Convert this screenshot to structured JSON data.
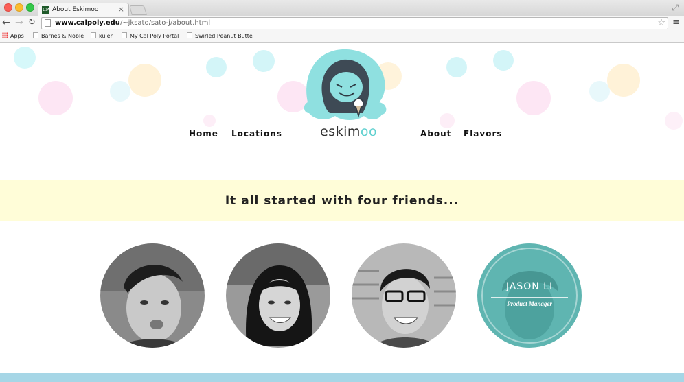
{
  "browser": {
    "tab_title": "About Eskimoo",
    "tab_favicon_text": "CP",
    "url_host": "www.calpoly.edu",
    "url_path": "/~jksato/sato-j/about.html",
    "bookmarks": [
      "Apps",
      "Barnes & Noble",
      "kuler",
      "My Cal Poly Portal",
      "Swirled Peanut Butte"
    ]
  },
  "site": {
    "nav_left": [
      "Home",
      "Locations"
    ],
    "nav_right": [
      "About",
      "Flavors"
    ],
    "logo_prefix": "eskim",
    "logo_accent": "oo",
    "band_heading": "It all started with four friends...",
    "team": [
      {
        "name": "",
        "role": ""
      },
      {
        "name": "",
        "role": ""
      },
      {
        "name": "",
        "role": ""
      },
      {
        "name": "JASON LI",
        "role": "Product Manager"
      }
    ]
  },
  "colors": {
    "accent_teal": "#5fd0cf",
    "band_yellow": "#fffdd8",
    "footer_blue": "#a6d6e6",
    "member_overlay": "#5fb5b1"
  },
  "icons": [
    "back-icon",
    "forward-icon",
    "reload-icon",
    "page-icon",
    "star-icon",
    "menu-icon",
    "folder-icon"
  ]
}
